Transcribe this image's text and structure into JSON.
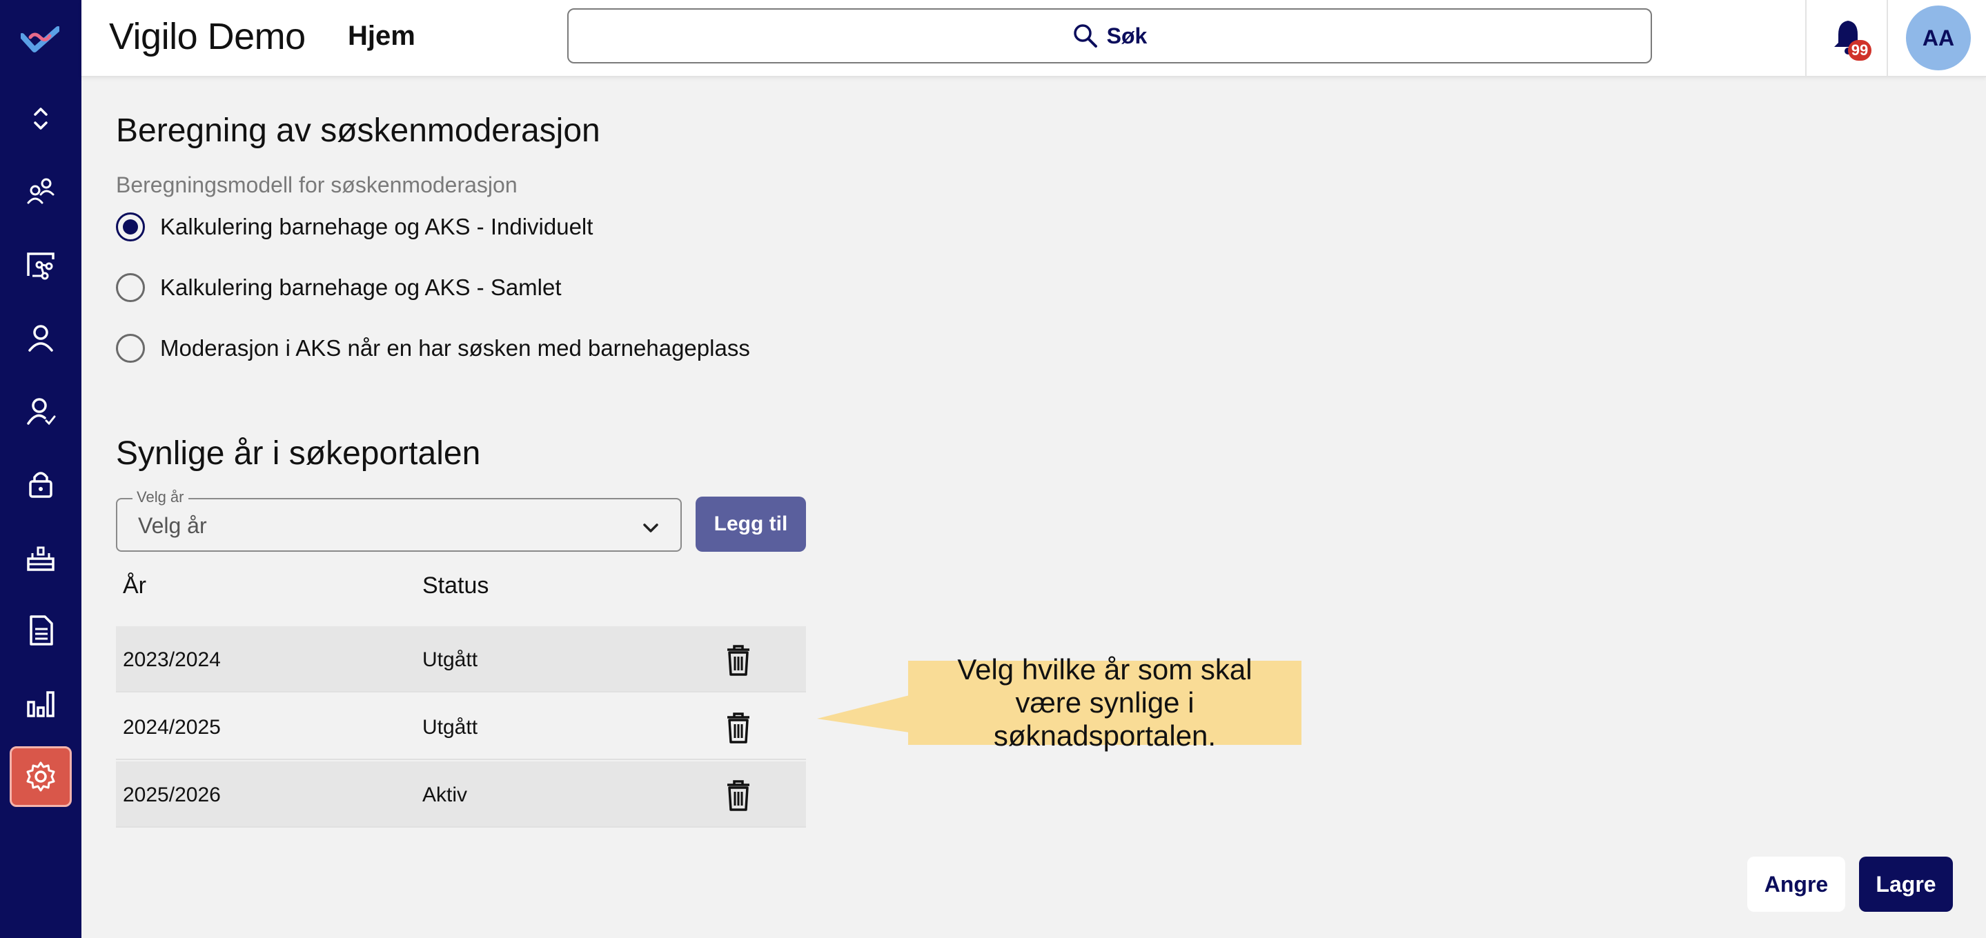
{
  "header": {
    "app_title": "Vigilo Demo",
    "home_label": "Hjem",
    "search_label": "Søk",
    "notification_count": "99",
    "avatar_initials": "AA"
  },
  "sidebar": {
    "items": [
      {
        "icon": "expand-collapse-icon"
      },
      {
        "icon": "groups-icon"
      },
      {
        "icon": "network-icon"
      },
      {
        "icon": "person-icon"
      },
      {
        "icon": "person-check-icon"
      },
      {
        "icon": "lock-icon"
      },
      {
        "icon": "kindergarten-icon"
      },
      {
        "icon": "document-icon"
      },
      {
        "icon": "bar-chart-icon"
      },
      {
        "icon": "gear-icon",
        "active": true
      }
    ],
    "active_color": "#d9574a",
    "background": "#0b0d5c"
  },
  "sibling_discount": {
    "title": "Beregning av søskenmoderasjon",
    "model_label": "Beregningsmodell for søskenmoderasjon",
    "options": [
      {
        "label": "Kalkulering barnehage og AKS - Individuelt",
        "checked": true
      },
      {
        "label": "Kalkulering barnehage og AKS - Samlet",
        "checked": false
      },
      {
        "label": "Moderasjon i AKS når en har søsken med barnehageplass",
        "checked": false
      }
    ]
  },
  "visible_years": {
    "title": "Synlige år i søkeportalen",
    "select_legend": "Velg år",
    "select_value": "Velg år",
    "add_button": "Legg til",
    "columns": [
      "År",
      "Status"
    ],
    "rows": [
      {
        "year": "2023/2024",
        "status": "Utgått"
      },
      {
        "year": "2024/2025",
        "status": "Utgått"
      },
      {
        "year": "2025/2026",
        "status": "Aktiv"
      }
    ]
  },
  "callout": {
    "text": "Velg hvilke år som skal være synlige i søknadsportalen.",
    "color": "#f9dc96"
  },
  "footer": {
    "cancel_label": "Angre",
    "save_label": "Lagre"
  }
}
